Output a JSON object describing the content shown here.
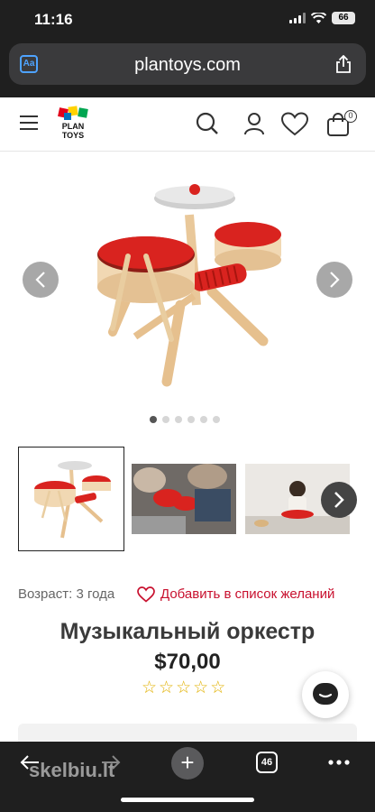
{
  "status_bar": {
    "time": "11:16",
    "battery": "66"
  },
  "browser": {
    "url": "plantoys.com",
    "tabs_count": "46",
    "watermark": "skelbiu.lt"
  },
  "header": {
    "logo_line1": "PLAN",
    "logo_line2": "TOYS",
    "cart_count": "0"
  },
  "gallery": {
    "dot_count": 6,
    "active_dot": 0
  },
  "product": {
    "age_label": "Возраст: 3 года",
    "wishlist_label": "Добавить в список желаний",
    "title": "Музыкальный оркестр",
    "price": "$70,00",
    "rating": 0,
    "stars_total": 5
  },
  "colors": {
    "accent": "#c8102e",
    "star": "#e2b100",
    "drum_red": "#d9231f"
  }
}
